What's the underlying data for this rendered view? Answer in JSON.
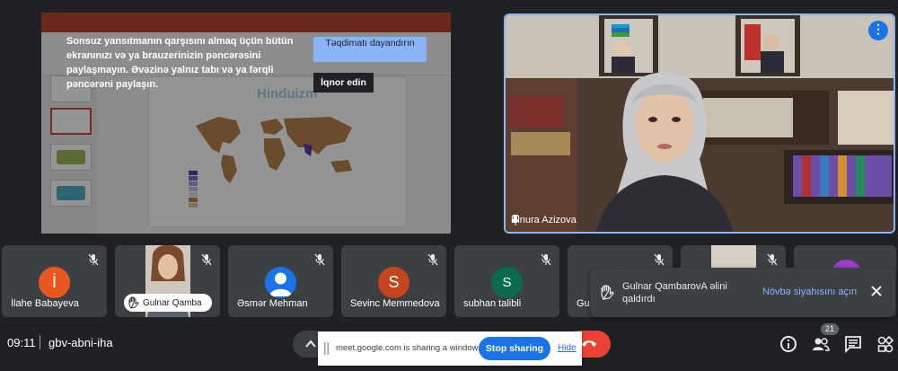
{
  "presentation": {
    "slide_title": "Hinduizm",
    "share_message": "Sonsuz yansıtmanın qarşısını almaq üçün bütün ekranınızı və ya brauzerinizin pəncərəsini paylaşmayın. Əvəzinə yalnız tabı və ya fərqli pəncərəni paylaşın.",
    "stop_presenting_label": "Təqdimatı dayandırın",
    "ignore_label": "İqnor edin"
  },
  "speaker": {
    "name": "Elnura Azizova",
    "menu_icon": "more-options-icon"
  },
  "participants": [
    {
      "name": "İlahe Babayeva",
      "initial": "İ",
      "color": "#e8571f",
      "muted": true
    },
    {
      "name": "Gulnar Qambarova",
      "initial": "",
      "color": "",
      "muted": true,
      "video": true,
      "hand_raised": true
    },
    {
      "name": "Əsmər Mehman",
      "initial": "",
      "color": "#1a73e8",
      "muted": true,
      "generic_avatar": true
    },
    {
      "name": "Sevinc Memmedova",
      "initial": "S",
      "color": "#c5451d",
      "muted": true
    },
    {
      "name": "subhan talibli",
      "initial": "S",
      "color": "#0b6b4f",
      "muted": true
    },
    {
      "name": "Gu",
      "initial": "",
      "color": "#2a6a8a",
      "muted": true
    },
    {
      "name": "",
      "initial": "",
      "color": "",
      "muted": true,
      "video": true
    },
    {
      "name": "",
      "initial": "",
      "color": "#9c3fc9",
      "muted": false
    }
  ],
  "hand_pill_label": "Gulnar Qamba",
  "toast": {
    "message": "Gulnar QambarovA əlini qaldırdı",
    "link_label": "Növbə siyahısını açın"
  },
  "bottom_bar": {
    "time": "09:11",
    "meeting_code": "gbv-abni-iha",
    "participant_count": "21"
  },
  "sharing_bar": {
    "message": "meet.google.com is sharing a window.",
    "stop_label": "Stop sharing",
    "hide_label": "Hide"
  },
  "colors": {
    "accent": "#8ab4f8",
    "end_call": "#ea4335",
    "primary_blue": "#1a73e8",
    "background": "#202124",
    "tile": "#3c4043"
  }
}
